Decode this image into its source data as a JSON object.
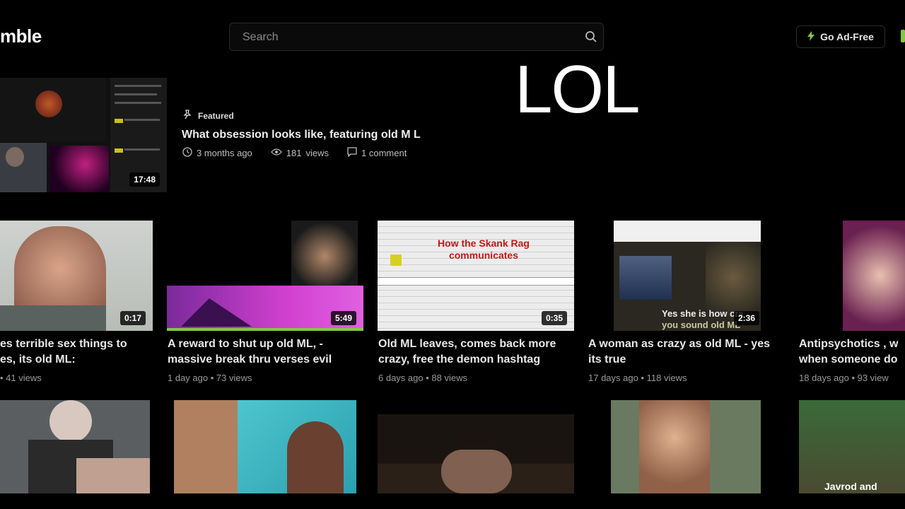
{
  "header": {
    "logo_text": "mble",
    "search_placeholder": "Search",
    "ad_free_label": "Go Ad-Free"
  },
  "overlay_text": "LOL",
  "featured": {
    "label": "Featured",
    "title": "What obsession looks like, featuring old M L",
    "time": "3 months ago",
    "views": "181",
    "views_label": "views",
    "comments": "1 comment",
    "duration": "17:48"
  },
  "cards": [
    {
      "title_line1": "es terrible sex things to",
      "title_line2": "es, its old ML:",
      "meta": "• 41  views",
      "duration": "0:17"
    },
    {
      "title_line1": "A reward to shut up old ML, -",
      "title_line2": "massive break thru verses evil",
      "meta": "1 day ago • 73  views",
      "duration": "5:49"
    },
    {
      "title_line1": "Old ML leaves, comes back more",
      "title_line2": "crazy, free the demon hashtag",
      "meta": "6 days ago • 88  views",
      "duration": "0:35",
      "thumb_text_1": "How the Skank Rag",
      "thumb_text_2": "communicates"
    },
    {
      "title_line1": "A woman as crazy as old ML - yes",
      "title_line2": "its true",
      "meta": "17 days ago • 118  views",
      "duration": "2:36",
      "thumb_text_1": "Yes she is how cra",
      "thumb_text_2": "you sound old ML"
    },
    {
      "title_line1": "Antipsychotics , w",
      "title_line2": "when someone do",
      "meta": "18 days ago • 93  view"
    }
  ],
  "row2": {
    "last_label": "Javrod and"
  },
  "colors": {
    "background": "#000000",
    "accent_green": "#85c742"
  }
}
